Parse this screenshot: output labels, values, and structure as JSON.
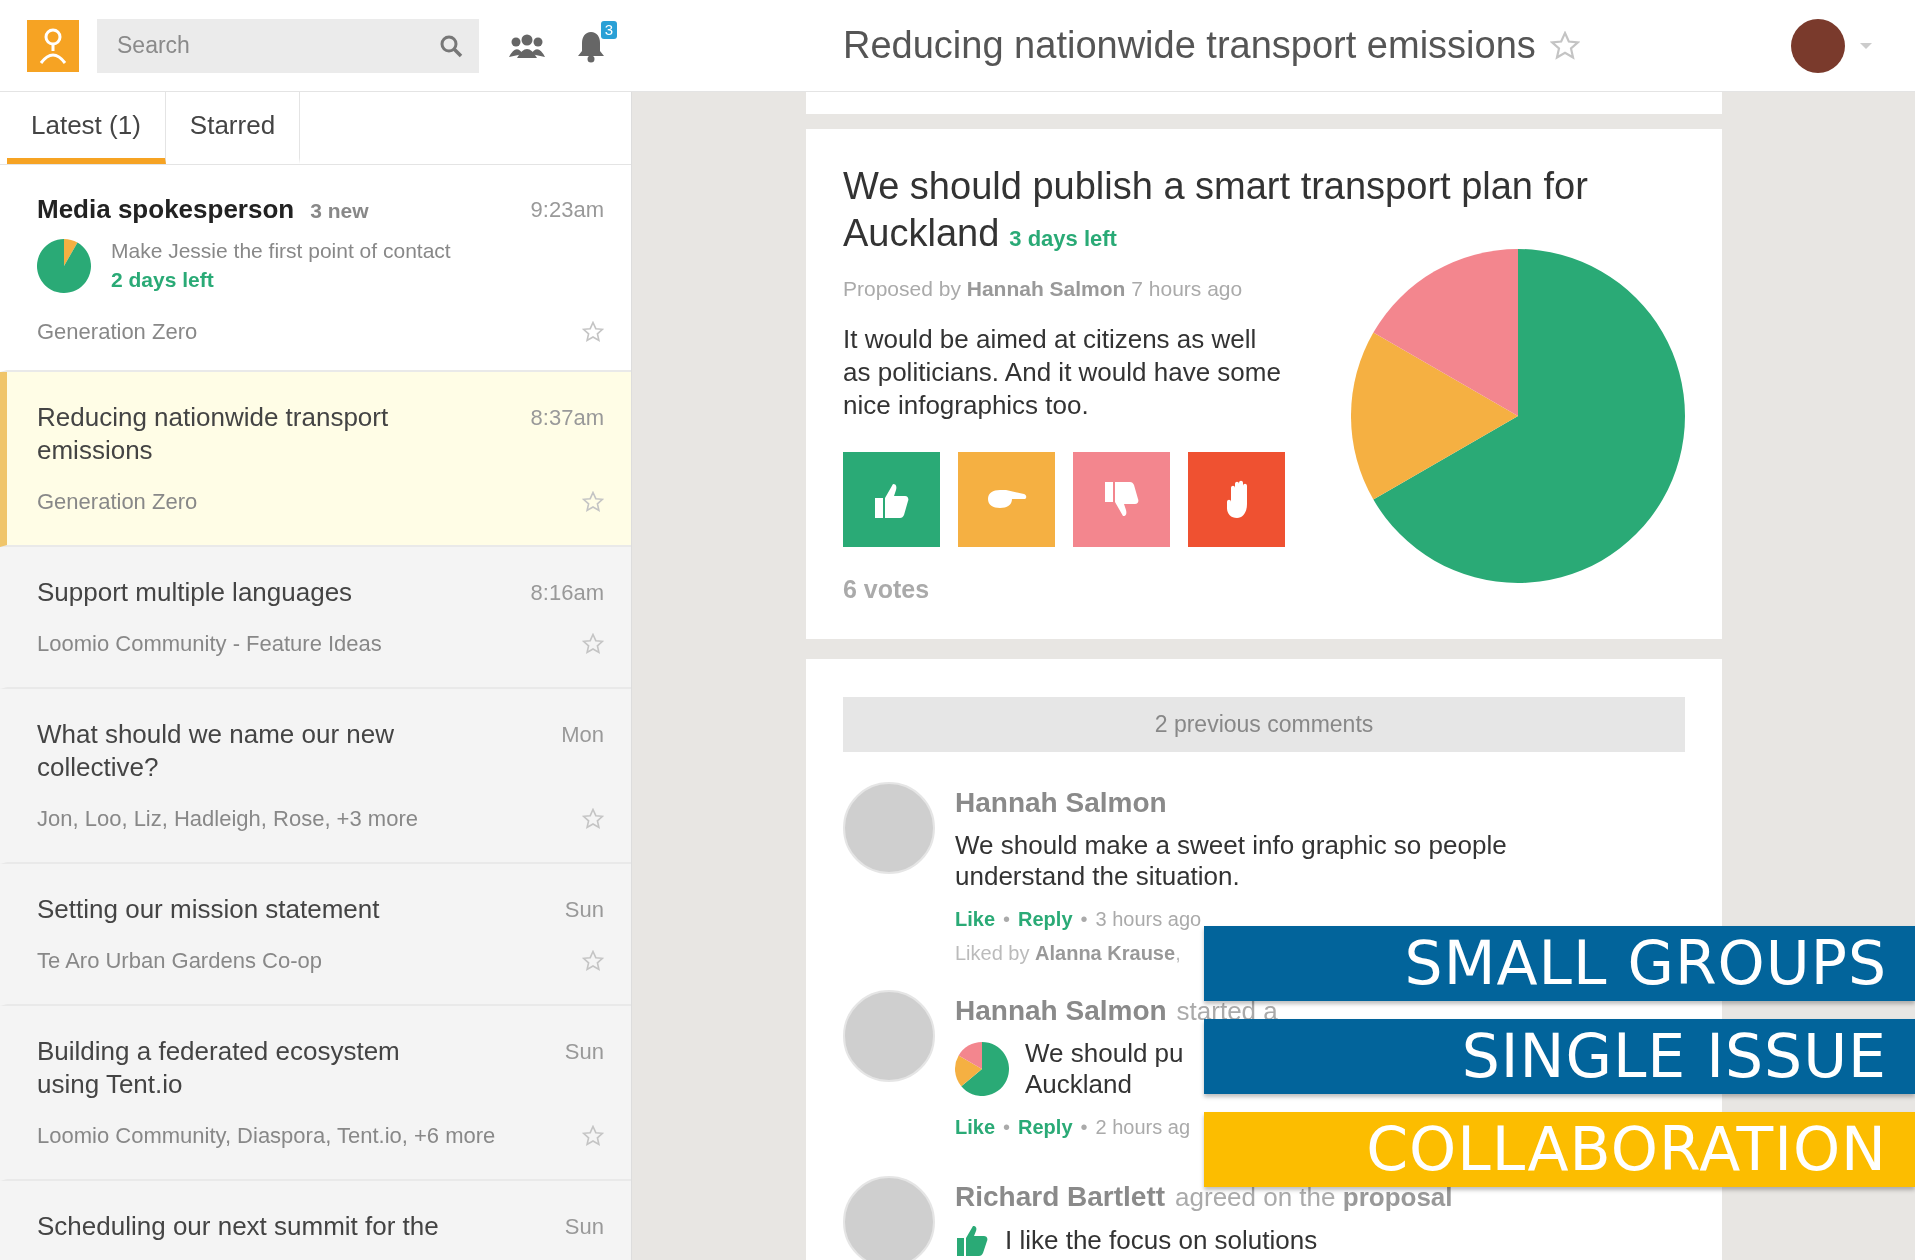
{
  "topbar": {
    "search": {
      "placeholder": "Search"
    },
    "notification_count": "3",
    "title": "Reducing nationwide transport emissions",
    "title_starred": false
  },
  "tabs": [
    {
      "label": "Latest (1)",
      "selected": true
    },
    {
      "label": "Starred",
      "selected": false
    }
  ],
  "threads": [
    {
      "kind": "proposal",
      "title": "Media spokesperson",
      "new_count": "3 new",
      "time": "9:23am",
      "proposal_text": "Make Jessie the first point of contact",
      "proposal_deadline": "2 days left",
      "group": "Generation Zero",
      "unread": true,
      "selected": false,
      "starred": false
    },
    {
      "kind": "plain",
      "title": "Reducing nationwide transport emissions",
      "time": "8:37am",
      "group": "Generation Zero",
      "unread": false,
      "selected": true,
      "starred": false
    },
    {
      "kind": "plain",
      "title": "Support multiple languages",
      "time": "8:16am",
      "group": "Loomio Community - Feature Ideas",
      "unread": false,
      "selected": false,
      "starred": false
    },
    {
      "kind": "plain",
      "title": "What should we name our new collective?",
      "time": "Mon",
      "group": "Jon, Loo, Liz, Hadleigh, Rose, +3 more",
      "unread": false,
      "selected": false,
      "starred": false
    },
    {
      "kind": "plain",
      "title": "Setting our mission statement",
      "time": "Sun",
      "group": "Te Aro Urban Gardens Co-op",
      "unread": false,
      "selected": false,
      "starred": false
    },
    {
      "kind": "plain",
      "title": "Building a federated ecosystem using Tent.io",
      "time": "Sun",
      "group": "Loomio Community, Diaspora, Tent.io, +6 more",
      "unread": false,
      "selected": false,
      "starred": false
    },
    {
      "kind": "plain",
      "title": "Scheduling our next summit for the",
      "time": "Sun",
      "unread": false,
      "selected": false
    }
  ],
  "proposal": {
    "title": [
      "We should publish a smart transport plan for",
      "Auckland"
    ],
    "deadline": "3 days left",
    "byline": "Proposed by **Hannah Salmon** 7 hours ago",
    "description": "It would be aimed at citizens as well as politicians. And it would have some nice infographics too.",
    "vote_buttons": [
      {
        "kind": "agree",
        "color": "#2aaa76"
      },
      {
        "kind": "abstain",
        "color": "#f5b042"
      },
      {
        "kind": "disagree",
        "color": "#f3868e"
      },
      {
        "kind": "block",
        "color": "#ef5131"
      }
    ],
    "votes": "6 votes"
  },
  "comments": {
    "previous": "2 previous comments",
    "separator": "•",
    "items": [
      {
        "kind": "comment",
        "author": "Hannah Salmon",
        "body": [
          "We should make a sweet info graphic so people",
          "understand the situation."
        ],
        "actions": [
          "Like",
          "Reply"
        ],
        "time": "3 hours ago",
        "liked_by": "Liked by **Alanna Krause**,"
      },
      {
        "kind": "proposal",
        "author": "Hannah Salmon",
        "action": "started a",
        "body": [
          "We should pu",
          "Auckland"
        ],
        "actions": [
          "Like",
          "Reply"
        ],
        "time": "2 hours ag"
      },
      {
        "kind": "vote",
        "author": "Richard Bartlett",
        "action": "agreed on the **proposal**",
        "body": [
          "I like the focus on solutions"
        ]
      }
    ]
  },
  "banners": [
    {
      "text": "SMALL GROUPS",
      "color": "#02649b"
    },
    {
      "text": "SINGLE ISSUE",
      "color": "#02649b"
    },
    {
      "text": "COLLABORATION",
      "color": "#fcbd00"
    }
  ]
}
